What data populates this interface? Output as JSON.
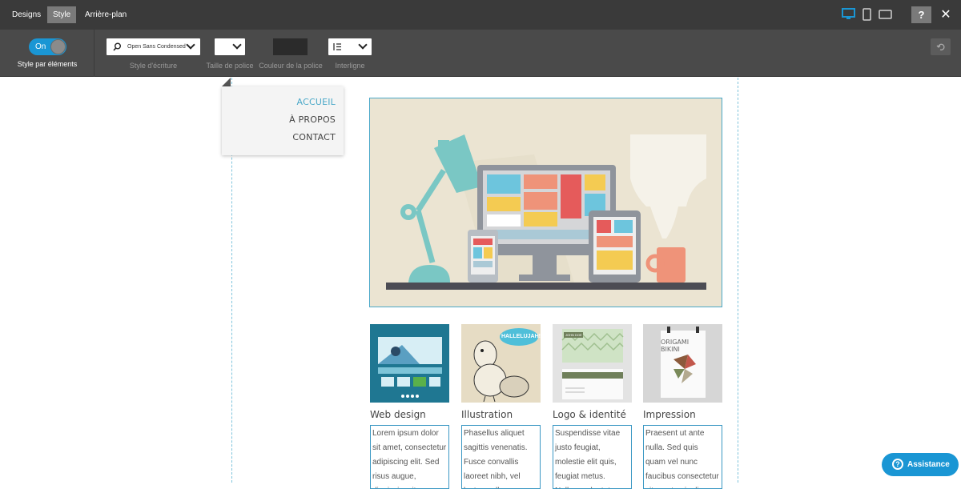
{
  "topbar": {
    "tabs": [
      {
        "label": "Designs",
        "active": false
      },
      {
        "label": "Style",
        "active": true
      },
      {
        "label": "Arrière-plan",
        "active": false
      }
    ],
    "devices": [
      "desktop-icon",
      "phone-icon",
      "tablet-landscape-icon"
    ],
    "active_device": "desktop",
    "help_label": "?",
    "close_label": "✕"
  },
  "toolbar": {
    "toggle_state": "On",
    "toggle_caption": "Style par éléments",
    "font_value": "Open Sans Condensed",
    "font_caption": "Style d'écriture",
    "size_caption": "Taille de police",
    "color_caption": "Couleur de la police",
    "color_value": "#2b2b2b",
    "lineheight_caption": "Interligne",
    "undo_icon": "undo-icon"
  },
  "nav": {
    "items": [
      {
        "label": "ACCUEIL",
        "active": true
      },
      {
        "label": "À PROPOS",
        "active": false
      },
      {
        "label": "CONTACT",
        "active": false
      }
    ]
  },
  "cards": [
    {
      "title": "Web design",
      "text": "Lorem ipsum dolor sit amet, consectetur adipiscing elit. Sed risus augue, dignissim sit"
    },
    {
      "title": "Illustration",
      "text": "Phasellus aliquet sagittis venenatis. Fusce convallis laoreet nibh, vel luctus nulla cursus"
    },
    {
      "title": "Logo & identité",
      "text": "Suspendisse vitae justo feugiat, molestie elit quis, feugiat metus. Nullam vulputate, dolor"
    },
    {
      "title": "Impression",
      "text": "Praesent ut ante nulla. Sed quis quam vel nunc faucibus consectetur sit amet quis diam. Aenean"
    }
  ],
  "thumbs": {
    "bubble_text": "HALLELUJAH!",
    "card_name": "JOHN DOE",
    "poster_title": "ORIGAMI BIKINI"
  },
  "assist_label": "Assistance",
  "colors": {
    "accent": "#1a96d4",
    "nav_active": "#4aa8c8"
  }
}
